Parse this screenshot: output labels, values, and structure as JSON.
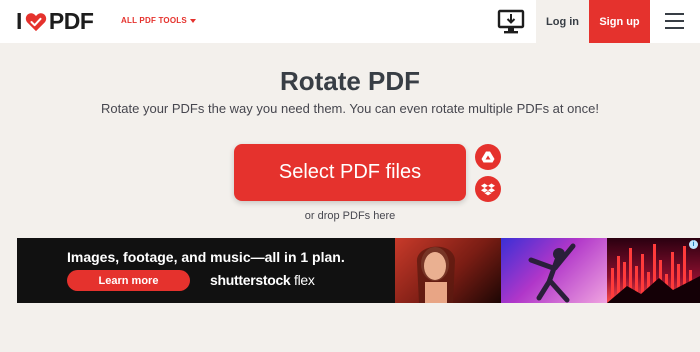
{
  "header": {
    "logo_left": "I",
    "logo_right": "PDF",
    "tools_menu_label": "ALL PDF TOOLS",
    "login_label": "Log in",
    "signup_label": "Sign up"
  },
  "main": {
    "title": "Rotate PDF",
    "subtitle": "Rotate your PDFs the way you need them. You can even rotate multiple PDFs at once!",
    "select_button_label": "Select PDF files",
    "drop_hint": "or drop PDFs here"
  },
  "ad": {
    "headline": "Images, footage, and music—all in 1 plan.",
    "cta_label": "Learn more",
    "brand_bold": "shutterstock",
    "brand_light": " flex",
    "info_symbol": "i"
  },
  "icons": {
    "heart": "heart-icon",
    "desktop": "desktop-download-icon",
    "menu": "hamburger-menu-icon",
    "google_drive": "google-drive-icon",
    "dropbox": "dropbox-icon"
  },
  "colors": {
    "brand_red": "#e5322d",
    "background": "#f3f0ec",
    "text_dark": "#383e45"
  }
}
